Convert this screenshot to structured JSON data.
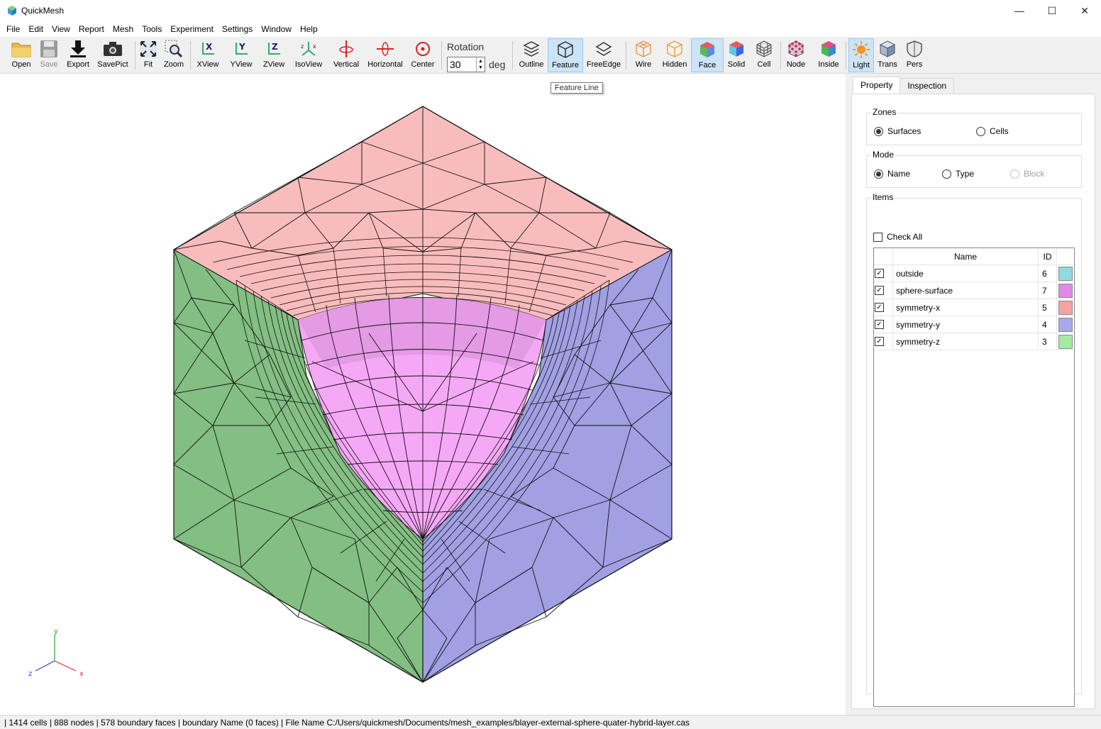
{
  "window": {
    "title": "QuickMesh",
    "minimize": "—",
    "maximize": "☐",
    "close": "✕"
  },
  "menu": [
    "File",
    "Edit",
    "View",
    "Report",
    "Mesh",
    "Tools",
    "Experiment",
    "Settings",
    "Window",
    "Help"
  ],
  "toolbar": {
    "open": "Open",
    "save": "Save",
    "export": "Export",
    "savepict": "SavePict",
    "fit": "Fit",
    "zoom": "Zoom",
    "xview": "XView",
    "yview": "YView",
    "zview": "ZView",
    "isoview": "IsoView",
    "vertical": "Vertical",
    "horizontal": "Horizontal",
    "center": "Center",
    "rotation_label": "Rotation",
    "rotation_value": "30",
    "rotation_unit": "deg",
    "outline": "Outline",
    "feature": "Feature",
    "freeedge": "FreeEdge",
    "wire": "Wire",
    "hidden": "Hidden",
    "face": "Face",
    "solid": "Solid",
    "cell": "Cell",
    "node": "Node",
    "inside": "Inside",
    "light": "Light",
    "trans": "Trans",
    "pers": "Pers"
  },
  "tooltip": "Feature Line",
  "axes": {
    "x": "x",
    "y": "y",
    "z": "z"
  },
  "panel": {
    "tabs": [
      "Property",
      "Inspection"
    ],
    "zones": {
      "title": "Zones",
      "surfaces": "Surfaces",
      "cells": "Cells"
    },
    "mode": {
      "title": "Mode",
      "name": "Name",
      "type": "Type",
      "block": "Block"
    },
    "items": {
      "title": "Items",
      "check_all": "Check All",
      "col_name": "Name",
      "col_id": "ID",
      "rows": [
        {
          "name": "outside",
          "id": "6",
          "color": "#8fdcdc"
        },
        {
          "name": "sphere-surface",
          "id": "7",
          "color": "#e08ae6"
        },
        {
          "name": "symmetry-x",
          "id": "5",
          "color": "#f4a3a3"
        },
        {
          "name": "symmetry-y",
          "id": "4",
          "color": "#a8a8ec"
        },
        {
          "name": "symmetry-z",
          "id": "3",
          "color": "#a3eaa3"
        }
      ]
    }
  },
  "status": "| 1414 cells | 888 nodes | 578 boundary faces |  boundary Name  (0 faces) | File Name C:/Users/quickmesh/Documents/mesh_examples/blayer-external-sphere-quater-hybrid-layer.cas",
  "colors": {
    "top": "#f9bcbc",
    "left": "#83be83",
    "right": "#a0a0e3",
    "sphere": "#f5a8f5",
    "sphere_dark": "#d98ad9"
  }
}
